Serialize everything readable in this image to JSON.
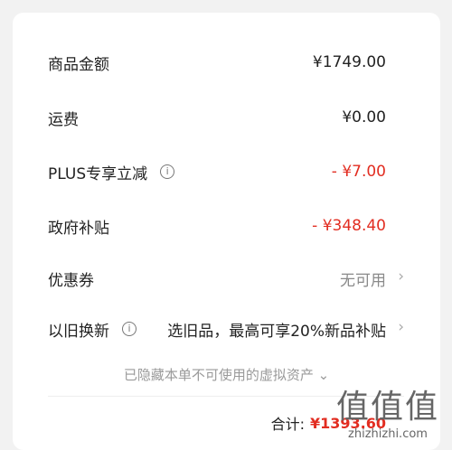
{
  "rows": [
    {
      "label": "商品金额",
      "value": "¥1749.00"
    },
    {
      "label": "运费",
      "value": "¥0.00"
    },
    {
      "label": "PLUS专享立减",
      "value": "- ¥7.00"
    },
    {
      "label": "政府补贴",
      "value": "- ¥348.40"
    },
    {
      "label": "优惠券",
      "value": "无可用"
    },
    {
      "label": "以旧换新",
      "value": "选旧品，最高可享20%新品补贴"
    }
  ],
  "info_icon_glyph": "i",
  "chevron_glyph": "›",
  "hidden_assets": "已隐藏本单不可使用的虚拟资产",
  "hidden_assets_chevron": "⌄",
  "total": {
    "label": "合计:",
    "value": "¥1393.60"
  },
  "watermark": {
    "logo": "值值值",
    "text": "zhizhizhi.com"
  },
  "colors": {
    "accent_red": "#e22d21",
    "muted_gray": "#8a8a8a",
    "background": "#f2f2f2"
  },
  "icons": {
    "info": "info-circle-icon",
    "chevron": "chevron-right-icon"
  }
}
